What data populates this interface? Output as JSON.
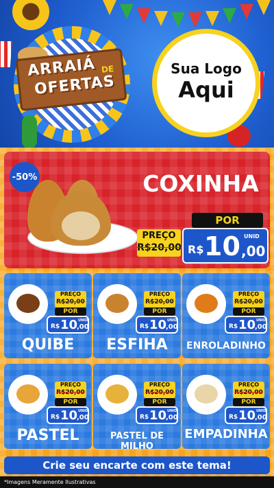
{
  "header": {
    "arraia": "ARRAIÁ",
    "de": "DE",
    "ofertas": "OFERTAS",
    "logo_line1": "Sua Logo",
    "logo_line2": "Aqui"
  },
  "hero": {
    "discount": "-50%",
    "name": "COXINHA",
    "preco_label": "PREÇO",
    "old_price": "R$20,00",
    "por_label": "POR",
    "currency": "R$",
    "price_int": "10",
    "price_dec": ",00",
    "unit": "UNID"
  },
  "products": [
    {
      "name": "QUIBE",
      "preco_label": "PREÇO",
      "old_price": "R$20,00",
      "por_label": "POR",
      "currency": "R$",
      "price_int": "10",
      "price_dec": ",00",
      "unit": "UNID"
    },
    {
      "name": "ESFIHA",
      "preco_label": "PREÇO",
      "old_price": "R$20,00",
      "por_label": "POR",
      "currency": "R$",
      "price_int": "10",
      "price_dec": ",00",
      "unit": "UNID"
    },
    {
      "name": "ENROLADINHO",
      "preco_label": "PREÇO",
      "old_price": "R$20,00",
      "por_label": "POR",
      "currency": "R$",
      "price_int": "10",
      "price_dec": ",00",
      "unit": "UNID"
    },
    {
      "name": "PASTEL",
      "preco_label": "PREÇO",
      "old_price": "R$20,00",
      "por_label": "POR",
      "currency": "R$",
      "price_int": "10",
      "price_dec": ",00",
      "unit": "UNID"
    },
    {
      "name": "PASTEL DE MILHO",
      "preco_label": "PREÇO",
      "old_price": "R$20,00",
      "por_label": "POR",
      "currency": "R$",
      "price_int": "10",
      "price_dec": ",00",
      "unit": "UNID"
    },
    {
      "name": "EMPADINHA",
      "preco_label": "PREÇO",
      "old_price": "R$20,00",
      "por_label": "POR",
      "currency": "R$",
      "price_int": "10",
      "price_dec": ",00",
      "unit": "UNID"
    }
  ],
  "cta": "Crie seu encarte com este tema!",
  "footer_note": "*Imagens Meramente Ilustrativas",
  "colors": {
    "blue": "#1d56c9",
    "red": "#d8232a",
    "yellow": "#f7d21e",
    "orange": "#f7a41a"
  }
}
